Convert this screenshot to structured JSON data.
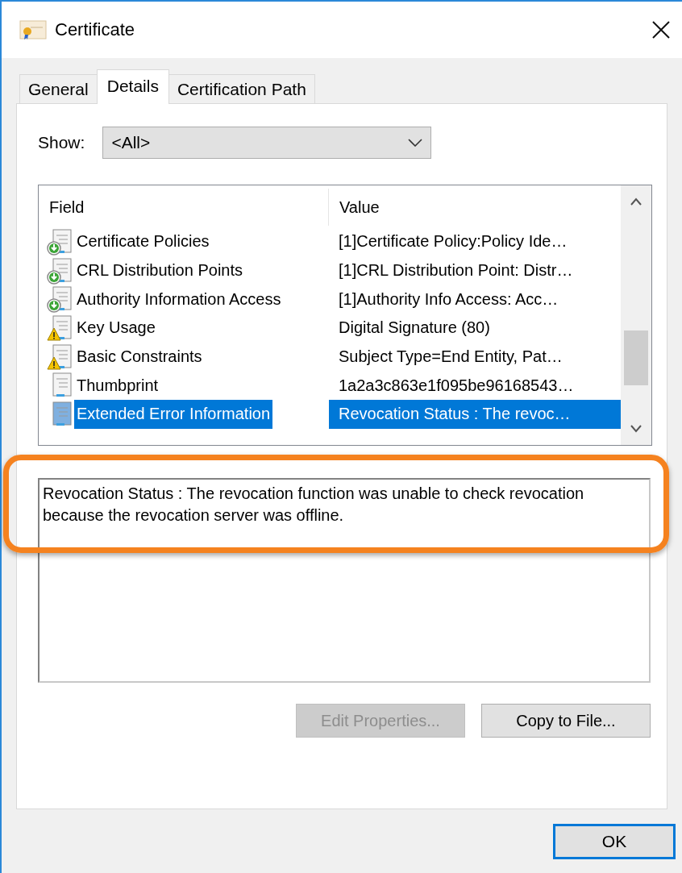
{
  "window": {
    "title": "Certificate"
  },
  "tabs": [
    {
      "label": "General",
      "selected": false
    },
    {
      "label": "Details",
      "selected": true
    },
    {
      "label": "Certification Path",
      "selected": false
    }
  ],
  "show": {
    "label": "Show:",
    "value": "<All>"
  },
  "table": {
    "columns": [
      "Field",
      "Value"
    ],
    "rows": [
      {
        "kind": "download",
        "field": "Certificate Policies",
        "value": "[1]Certificate Policy:Policy Ide…",
        "selected": false
      },
      {
        "kind": "download",
        "field": "CRL Distribution Points",
        "value": "[1]CRL Distribution Point: Distr…",
        "selected": false
      },
      {
        "kind": "download",
        "field": "Authority Information Access",
        "value": "[1]Authority Info Access: Acc…",
        "selected": false
      },
      {
        "kind": "warning",
        "field": "Key Usage",
        "value": "Digital Signature (80)",
        "selected": false
      },
      {
        "kind": "warning",
        "field": "Basic Constraints",
        "value": "Subject Type=End Entity, Pat…",
        "selected": false
      },
      {
        "kind": "plain",
        "field": "Thumbprint",
        "value": "1a2a3c863e1f095be96168543…",
        "selected": false
      },
      {
        "kind": "plain",
        "field": "Extended Error Information",
        "value": "Revocation Status : The revoc…",
        "selected": true
      }
    ]
  },
  "detail_text": "Revocation Status : The revocation function was unable to check revocation because the revocation server was offline.",
  "buttons": [
    {
      "label": "Edit Properties...",
      "disabled": true
    },
    {
      "label": "Copy to File...",
      "disabled": false
    }
  ],
  "ok_button": {
    "label": "OK",
    "default": true
  }
}
